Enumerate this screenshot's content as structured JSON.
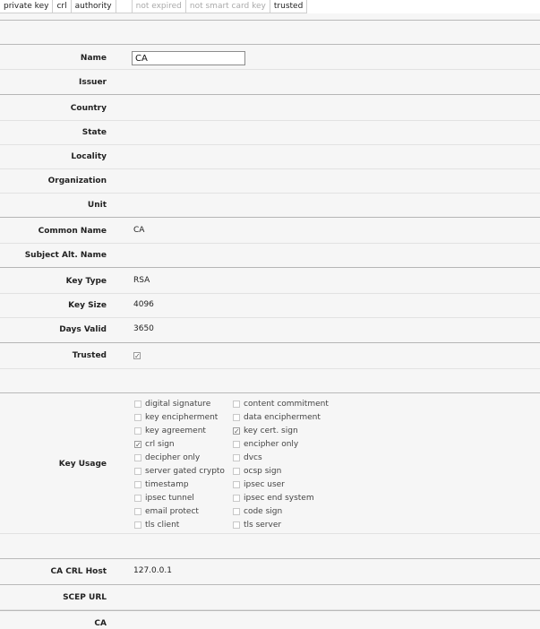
{
  "flags": [
    {
      "label": "private key",
      "enabled": true
    },
    {
      "label": "crl",
      "enabled": true
    },
    {
      "label": "authority",
      "enabled": true
    },
    {
      "label": "",
      "enabled": true
    },
    {
      "label": "not expired",
      "enabled": false
    },
    {
      "label": "not smart card key",
      "enabled": false
    },
    {
      "label": "trusted",
      "enabled": true
    }
  ],
  "form": {
    "name_label": "Name",
    "name_value": "CA",
    "issuer_label": "Issuer",
    "country_label": "Country",
    "state_label": "State",
    "locality_label": "Locality",
    "organization_label": "Organization",
    "unit_label": "Unit",
    "common_name_label": "Common Name",
    "common_name_value": "CA",
    "subject_alt_label": "Subject Alt. Name",
    "key_type_label": "Key Type",
    "key_type_value": "RSA",
    "key_size_label": "Key Size",
    "key_size_value": "4096",
    "days_valid_label": "Days Valid",
    "days_valid_value": "3650",
    "trusted_label": "Trusted",
    "trusted_checked": true,
    "key_usage_label": "Key Usage",
    "ca_crl_host_label": "CA CRL Host",
    "ca_crl_host_value": "127.0.0.1",
    "scep_url_label": "SCEP URL",
    "ca_label": "CA"
  },
  "key_usage": [
    {
      "label": "digital signature",
      "checked": false
    },
    {
      "label": "content commitment",
      "checked": false
    },
    {
      "label": "key encipherment",
      "checked": false
    },
    {
      "label": "data encipherment",
      "checked": false
    },
    {
      "label": "key agreement",
      "checked": false
    },
    {
      "label": "key cert. sign",
      "checked": true
    },
    {
      "label": "crl sign",
      "checked": true
    },
    {
      "label": "encipher only",
      "checked": false
    },
    {
      "label": "decipher only",
      "checked": false
    },
    {
      "label": "dvcs",
      "checked": false
    },
    {
      "label": "server gated crypto",
      "checked": false
    },
    {
      "label": "ocsp sign",
      "checked": false
    },
    {
      "label": "timestamp",
      "checked": false
    },
    {
      "label": "ipsec user",
      "checked": false
    },
    {
      "label": "ipsec tunnel",
      "checked": false
    },
    {
      "label": "ipsec end system",
      "checked": false
    },
    {
      "label": "email protect",
      "checked": false
    },
    {
      "label": "code sign",
      "checked": false
    },
    {
      "label": "tls client",
      "checked": false
    },
    {
      "label": "tls server",
      "checked": false
    }
  ]
}
